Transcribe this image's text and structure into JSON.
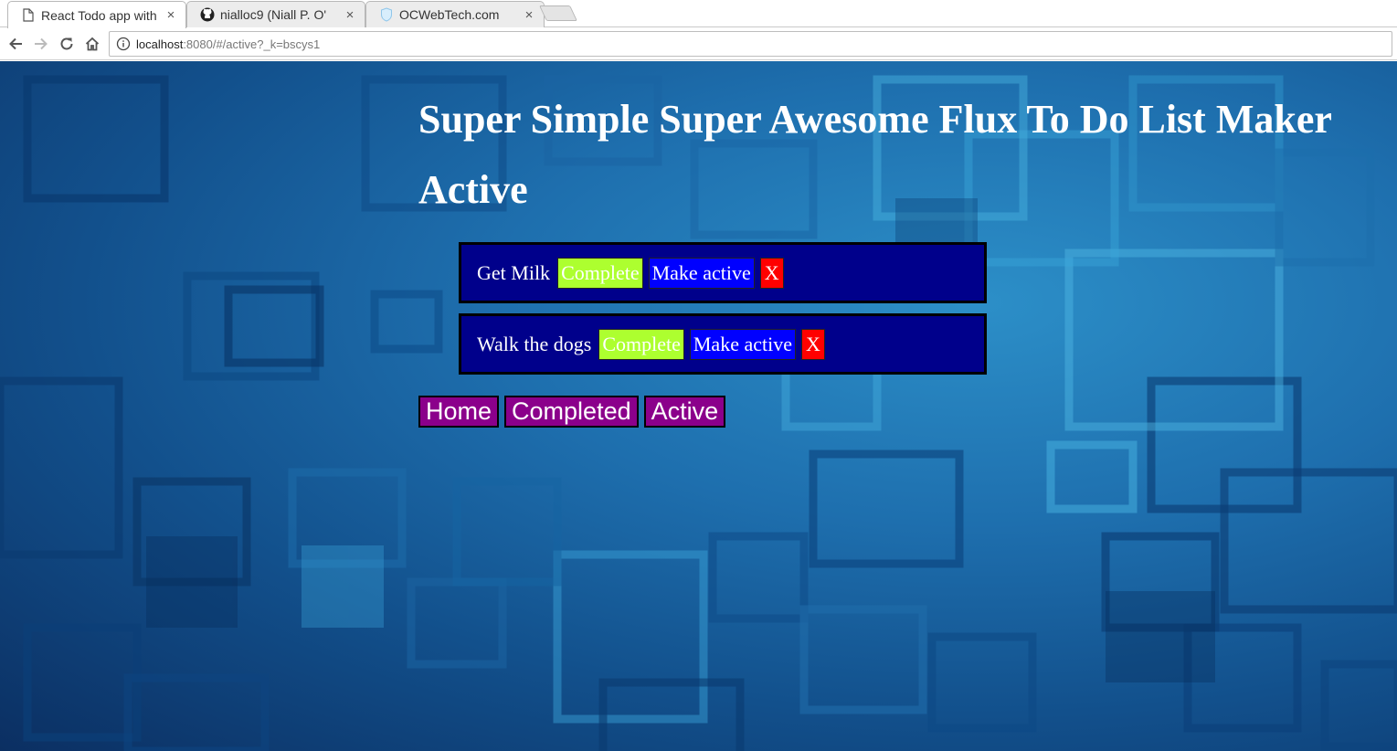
{
  "browser": {
    "tabs": [
      {
        "title": "React Todo app with",
        "icon": "document-icon",
        "active": true
      },
      {
        "title": "nialloc9 (Niall P. O'",
        "icon": "github-icon",
        "active": false
      },
      {
        "title": "OCWebTech.com",
        "icon": "shield-icon",
        "active": false
      }
    ],
    "tab_close": "×",
    "url_host": "localhost",
    "url_path": ":8080/#/active?_k=bscys1"
  },
  "app": {
    "title": "Super Simple Super Awesome Flux To Do List Maker",
    "section": "Active",
    "todos": [
      {
        "text": "Get Milk",
        "complete_label": "Complete",
        "active_label": "Make active",
        "delete_label": "X"
      },
      {
        "text": "Walk the dogs",
        "complete_label": "Complete",
        "active_label": "Make active",
        "delete_label": "X"
      }
    ],
    "nav": [
      {
        "label": "Home"
      },
      {
        "label": "Completed"
      },
      {
        "label": "Active"
      }
    ]
  },
  "colors": {
    "todo_bg": "#00008b",
    "complete_btn": "#adff2f",
    "active_btn": "#0000ff",
    "delete_btn": "#ff0000",
    "nav_bg": "#8b008b"
  }
}
